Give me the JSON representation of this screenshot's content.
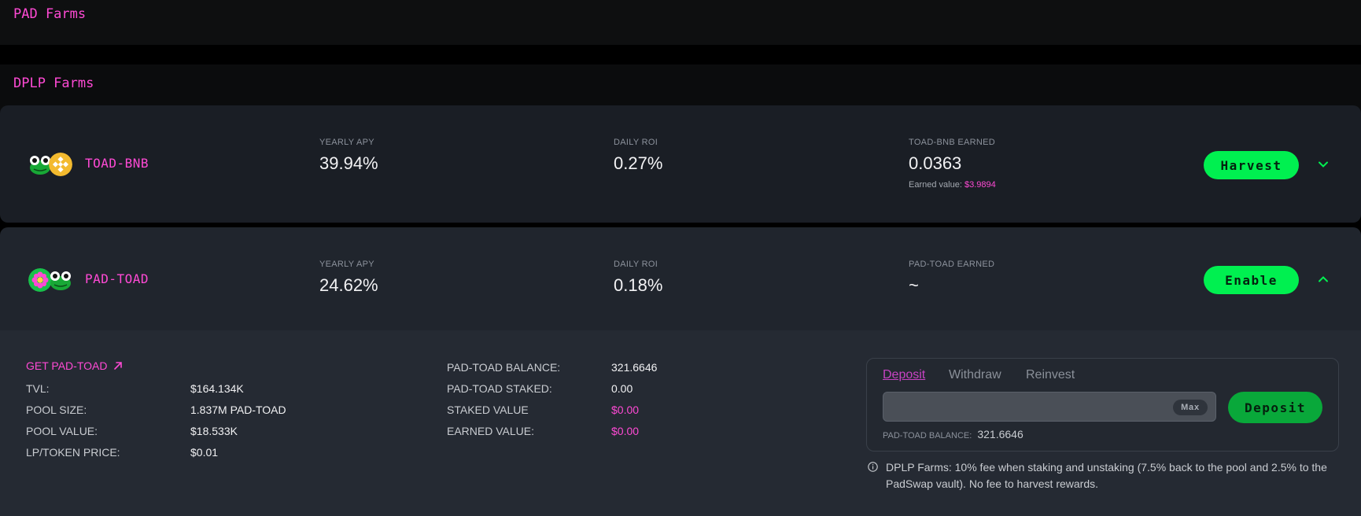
{
  "sections": {
    "pad_farms_title": "PAD Farms",
    "dplp_farms_title": "DPLP Farms"
  },
  "colors": {
    "accent_pink": "#ff4ad5",
    "accent_green": "#00f050",
    "background": "#000000"
  },
  "farms": [
    {
      "name": "TOAD-BNB",
      "icons": [
        "toad-token-icon",
        "bnb-token-icon"
      ],
      "apy_label": "YEARLY APY",
      "apy_value": "39.94%",
      "roi_label": "DAILY ROI",
      "roi_value": "0.27%",
      "earned_label": "TOAD-BNB EARNED",
      "earned_value": "0.0363",
      "earned_value_label": "Earned value:",
      "earned_value_usd": "$3.9894",
      "action_label": "Harvest",
      "expanded": false
    },
    {
      "name": "PAD-TOAD",
      "icons": [
        "pad-token-icon",
        "toad-token-icon"
      ],
      "apy_label": "YEARLY APY",
      "apy_value": "24.62%",
      "roi_label": "DAILY ROI",
      "roi_value": "0.18%",
      "earned_label": "PAD-TOAD EARNED",
      "earned_value": "~",
      "action_label": "Enable",
      "expanded": true
    }
  ],
  "details": {
    "get_link": "GET PAD-TOAD",
    "left": [
      {
        "label": "TVL:",
        "value": "$164.134K"
      },
      {
        "label": "POOL SIZE:",
        "value": "1.837M PAD-TOAD"
      },
      {
        "label": "POOL VALUE:",
        "value": "$18.533K"
      },
      {
        "label": "LP/TOKEN PRICE:",
        "value": "$0.01"
      }
    ],
    "middle": [
      {
        "label": "PAD-TOAD BALANCE:",
        "value": "321.6646"
      },
      {
        "label": "PAD-TOAD STAKED:",
        "value": "0.00"
      },
      {
        "label": "STAKED VALUE",
        "value": "$0.00"
      },
      {
        "label": "EARNED VALUE:",
        "value": "$0.00"
      }
    ],
    "tabs": [
      "Deposit",
      "Withdraw",
      "Reinvest"
    ],
    "active_tab": "Deposit",
    "amount_input": {
      "value": "",
      "placeholder": ""
    },
    "max_label": "Max",
    "deposit_label": "Deposit",
    "balance_label": "PAD-TOAD BALANCE:",
    "balance_value": "321.6646",
    "fee_note": "DPLP Farms: 10% fee when staking and unstaking (7.5% back to the pool and 2.5% to the PadSwap vault). No fee to harvest rewards."
  }
}
